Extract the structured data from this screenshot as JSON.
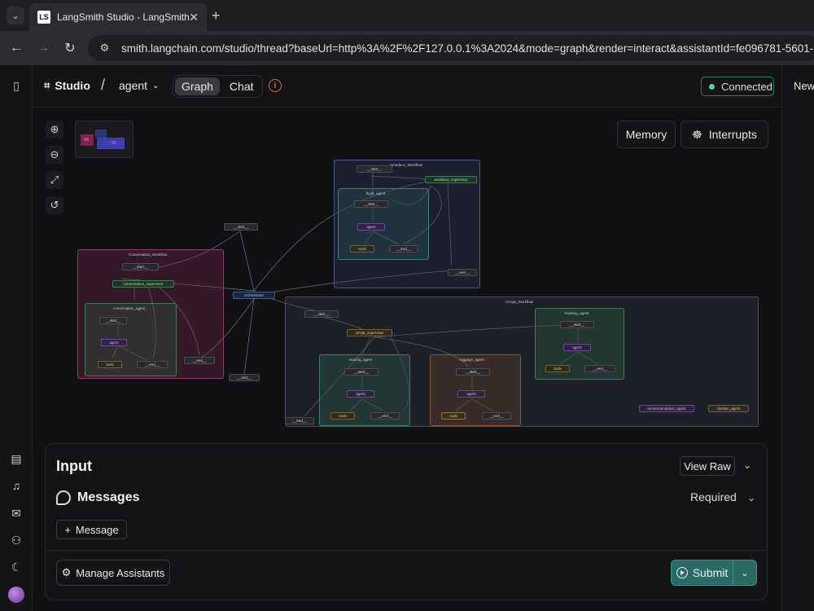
{
  "browser": {
    "tab_title": "LangSmith Studio - LangSmith",
    "favicon_text": "LS",
    "url": "smith.langchain.com/studio/thread?baseUrl=http%3A%2F%2F127.0.0.1%3A2024&mode=graph&render=interact&assistantId=fe096781-5601-53d2-b2"
  },
  "header": {
    "studio_label": "Studio",
    "crumb_sep": "/",
    "agent_label": "agent",
    "tabs": [
      {
        "label": "Graph",
        "active": true
      },
      {
        "label": "Chat",
        "active": false
      }
    ],
    "status_label": "Connected",
    "status_color": "#4ad6a0"
  },
  "right_panel": {
    "new_label": "New"
  },
  "canvas": {
    "memory_label": "Memory",
    "interrupts_label": "Interrupts"
  },
  "graph": {
    "groups": {
      "conversation": "Conversation_Workflow",
      "amadeus": "Amadeus_Workflow",
      "umoja": "Umoja_Workflow",
      "flight": "flight_agent",
      "conv_agent": "conversation_agent",
      "booking": "booking_agent",
      "seating": "seating_agent",
      "luggage": "luggage_agent"
    },
    "nodes": {
      "start": "__start__",
      "end": "__end__",
      "orchestrator": "orchestrator",
      "amadeus_supervisor": "amadeus_supervisor",
      "conversation_supervisor": "conversation_supervisor",
      "umoja_supervisor": "umoja_supervisor",
      "agent": "agent",
      "tools": "tools",
      "recommendation_agent": "recommendation_agent",
      "checkin_agent": "checkin_agent"
    }
  },
  "input_panel": {
    "title": "Input",
    "view_raw_label": "View Raw",
    "messages_label": "Messages",
    "required_label": "Required",
    "add_message_label": "Message",
    "manage_assistants_label": "Manage Assistants",
    "submit_label": "Submit"
  }
}
